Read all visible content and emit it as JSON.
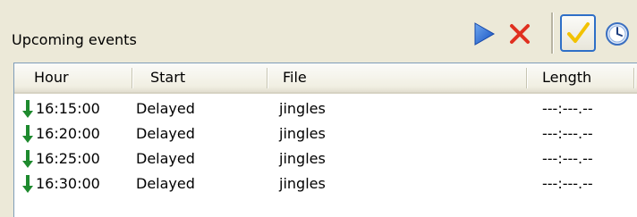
{
  "panel": {
    "title": "Upcoming events"
  },
  "toolbar": {
    "play_icon": "play-icon",
    "delete_icon": "delete-icon",
    "check_icon": "checkmark-icon",
    "clock_icon": "clock-icon",
    "play_color": "#1e64d8",
    "delete_color": "#e03020",
    "check_color": "#f2c200"
  },
  "columns": [
    "Hour",
    "Start",
    "File",
    "Length"
  ],
  "rows": [
    {
      "hour": "16:15:00",
      "start": "Delayed",
      "file": "jingles",
      "length": "---:---.--"
    },
    {
      "hour": "16:20:00",
      "start": "Delayed",
      "file": "jingles",
      "length": "---:---.--"
    },
    {
      "hour": "16:25:00",
      "start": "Delayed",
      "file": "jingles",
      "length": "---:---.--"
    },
    {
      "hour": "16:30:00",
      "start": "Delayed",
      "file": "jingles",
      "length": "---:---.--"
    }
  ],
  "row_icon": "down-arrow-icon",
  "row_icon_color": "#1e8a2e"
}
